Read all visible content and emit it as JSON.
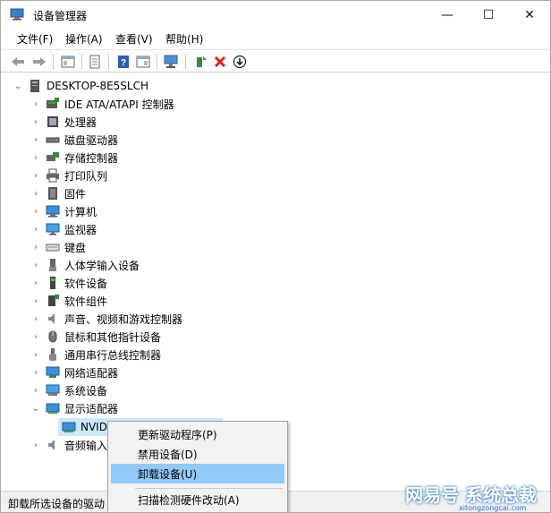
{
  "window": {
    "title": "设备管理器",
    "min": "—",
    "max": "☐",
    "close": "✕"
  },
  "menu": [
    "文件(F)",
    "操作(A)",
    "查看(V)",
    "帮助(H)"
  ],
  "tree": {
    "root": "DESKTOP-8E5SLCH",
    "categories": [
      {
        "label": "IDE ATA/ATAPI 控制器",
        "icon": "ide-controller-icon"
      },
      {
        "label": "处理器",
        "icon": "processor-icon"
      },
      {
        "label": "磁盘驱动器",
        "icon": "disk-drive-icon"
      },
      {
        "label": "存储控制器",
        "icon": "storage-controller-icon"
      },
      {
        "label": "打印队列",
        "icon": "printer-icon"
      },
      {
        "label": "固件",
        "icon": "firmware-icon"
      },
      {
        "label": "计算机",
        "icon": "computer-icon"
      },
      {
        "label": "监视器",
        "icon": "monitor-icon"
      },
      {
        "label": "键盘",
        "icon": "keyboard-icon"
      },
      {
        "label": "人体学输入设备",
        "icon": "hid-icon"
      },
      {
        "label": "软件设备",
        "icon": "software-device-icon"
      },
      {
        "label": "软件组件",
        "icon": "software-component-icon"
      },
      {
        "label": "声音、视频和游戏控制器",
        "icon": "sound-icon"
      },
      {
        "label": "鼠标和其他指针设备",
        "icon": "mouse-icon"
      },
      {
        "label": "通用串行总线控制器",
        "icon": "usb-icon"
      },
      {
        "label": "网络适配器",
        "icon": "network-adapter-icon"
      },
      {
        "label": "系统设备",
        "icon": "system-device-icon"
      },
      {
        "label": "显示适配器",
        "icon": "display-adapter-icon"
      }
    ],
    "child_selected": "NVID",
    "last_partial": "音频输入"
  },
  "context_menu": [
    "更新驱动程序(P)",
    "禁用设备(D)",
    "卸载设备(U)",
    "扫描检测硬件改动(A)"
  ],
  "status": "卸载所选设备的驱动",
  "watermark": {
    "text": "网易号 系统总裁",
    "sub": "xitongzongcai.com"
  }
}
